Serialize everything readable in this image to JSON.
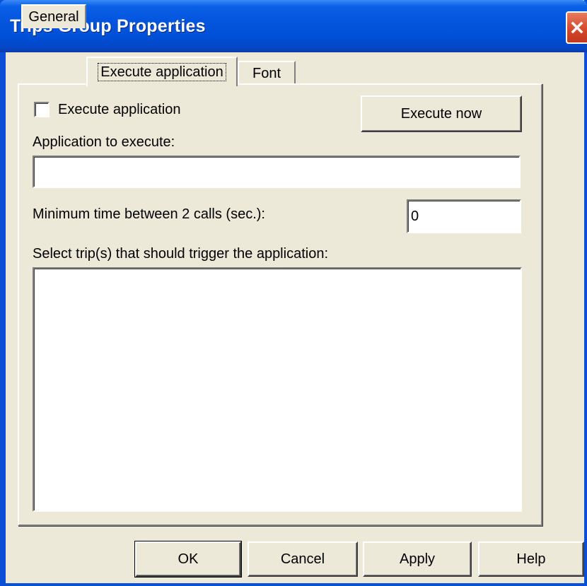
{
  "window": {
    "title": "Trips Group Properties"
  },
  "tabs": [
    {
      "label": "General",
      "active": false
    },
    {
      "label": "Execute application",
      "active": true
    },
    {
      "label": "Font",
      "active": false
    }
  ],
  "execute": {
    "checkbox_label": "Execute application",
    "checkbox_checked": false,
    "execute_now_label": "Execute now",
    "application_label": "Application to execute:",
    "application_value": "",
    "min_time_label": "Minimum time between 2 calls (sec.):",
    "min_time_value": "0",
    "trips_label": "Select trip(s) that should trigger the application:",
    "trips_items": []
  },
  "footer": {
    "ok_label": "OK",
    "cancel_label": "Cancel",
    "apply_label": "Apply",
    "help_label": "Help"
  },
  "colors": {
    "window_bg": "#ECE9D8",
    "titlebar": "#0050D8",
    "close_button": "#D3462A"
  },
  "icons": {
    "close": "close-icon"
  }
}
